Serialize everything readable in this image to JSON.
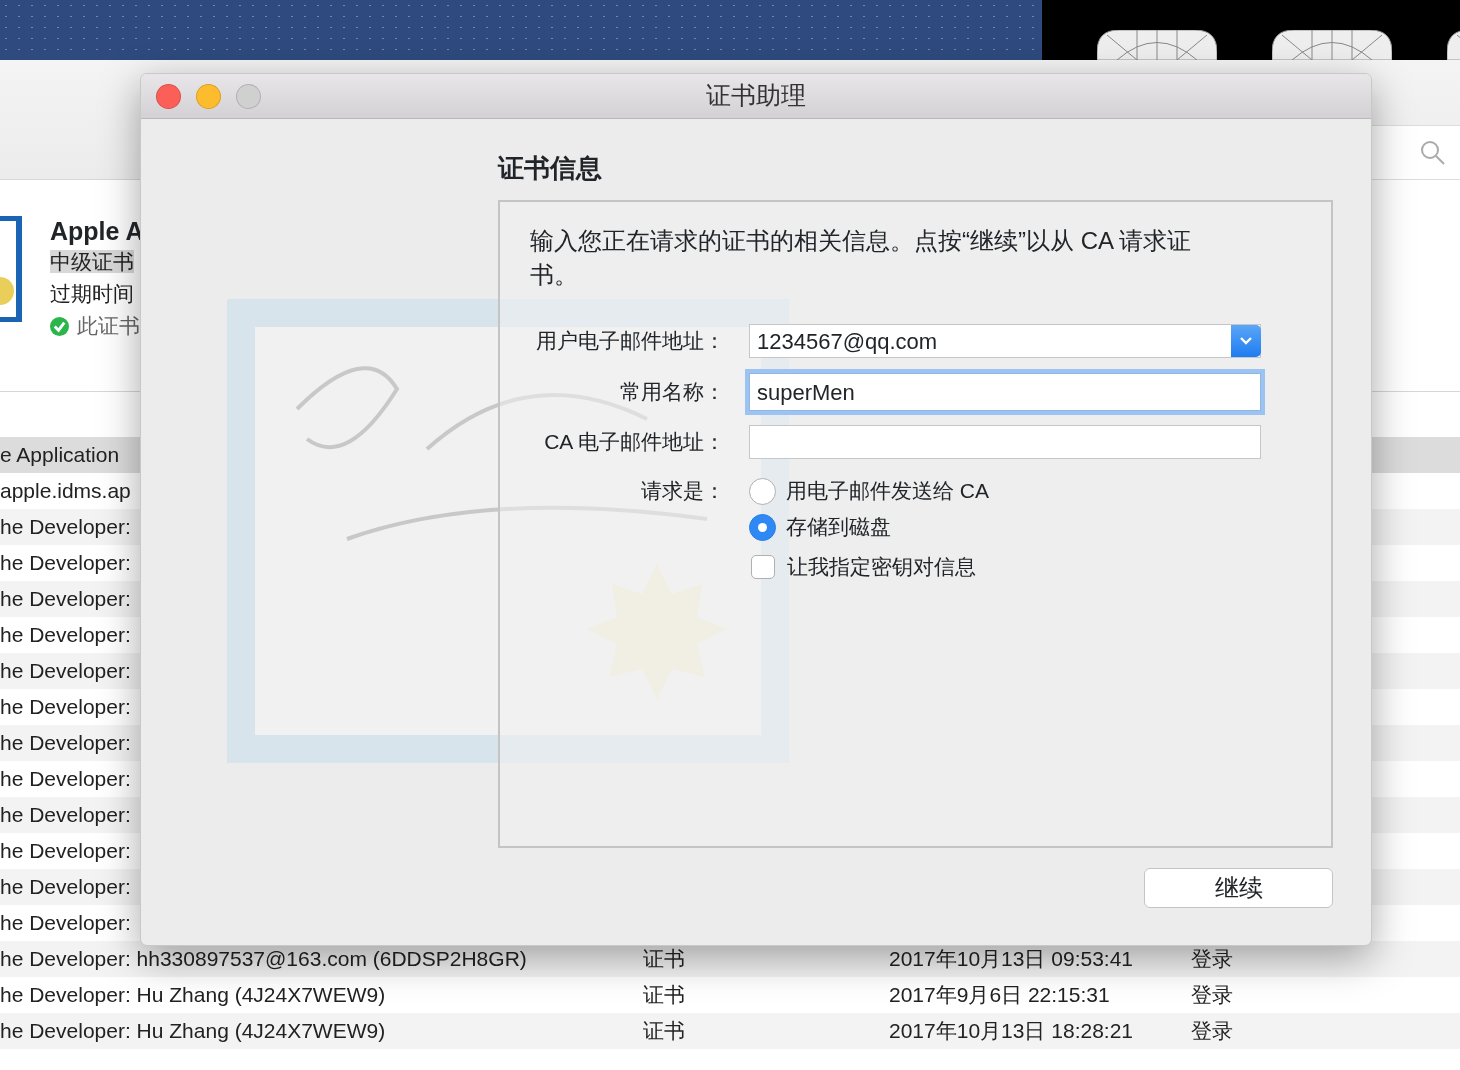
{
  "certificate_detail": {
    "title": "Apple A",
    "type": "中级证书",
    "expiry": "过期时间",
    "status": "此证书",
    "valid": true
  },
  "list_rows": [
    {
      "name": "e Application",
      "selected": true
    },
    {
      "name": "apple.idms.ap",
      "selected": false
    },
    {
      "name": "he Developer:",
      "selected": false
    },
    {
      "name": "he Developer:",
      "selected": false
    },
    {
      "name": "he Developer:",
      "selected": false
    },
    {
      "name": "he Developer:",
      "selected": false
    },
    {
      "name": "he Developer:",
      "selected": false
    },
    {
      "name": "he Developer:",
      "selected": false
    },
    {
      "name": "he Developer:",
      "selected": false
    },
    {
      "name": "he Developer:",
      "selected": false
    },
    {
      "name": "he Developer:",
      "selected": false
    },
    {
      "name": "he Developer:",
      "selected": false
    },
    {
      "name": "he Developer:",
      "selected": false
    },
    {
      "name": "he Developer:",
      "selected": false
    },
    {
      "name": "he Developer: hh330897537@163.com (6DDSP2H8GR)",
      "kind": "证书",
      "date": "2017年10月13日 09:53:41",
      "keychain": "登录",
      "selected": false
    },
    {
      "name": "he Developer: Hu Zhang (4J24X7WEW9)",
      "kind": "证书",
      "date": "2017年9月6日 22:15:31",
      "keychain": "登录",
      "selected": false
    },
    {
      "name": "he Developer: Hu Zhang (4J24X7WEW9)",
      "kind": "证书",
      "date": "2017年10月13日 18:28:21",
      "keychain": "登录",
      "selected": false
    }
  ],
  "dialog": {
    "title": "证书助理",
    "heading": "证书信息",
    "intro": "输入您正在请求的证书的相关信息。点按“继续”以从 CA 请求证书。",
    "fields": [
      {
        "label": "用户电子邮件地址：",
        "value": "1234567@qq.com",
        "kind": "combo",
        "focused": false
      },
      {
        "label": "常用名称：",
        "value": "superMen",
        "kind": "text",
        "focused": true
      },
      {
        "label": "CA 电子邮件地址：",
        "kind": "text",
        "focused": false
      }
    ],
    "request_label": "请求是：",
    "options": [
      {
        "label": "用电子邮件发送给 CA",
        "kind": "radio",
        "selected": false
      },
      {
        "label": "存储到磁盘",
        "kind": "radio",
        "selected": true
      },
      {
        "label": "让我指定密钥对信息",
        "kind": "checkbox",
        "checked": false
      }
    ],
    "button": "继续"
  }
}
